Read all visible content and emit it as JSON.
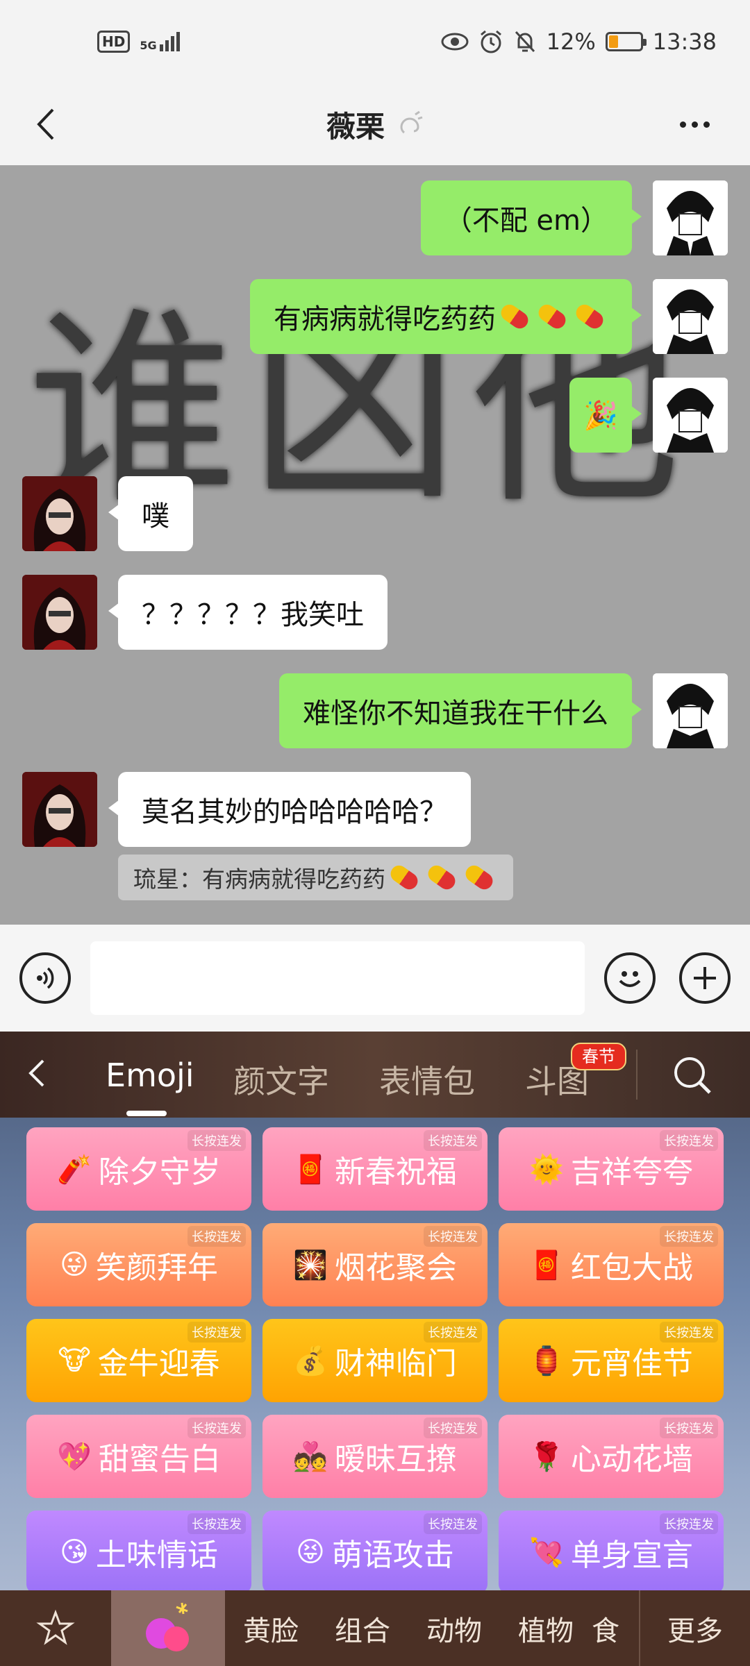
{
  "status_bar": {
    "hd_label": "HD",
    "network_label": "5G",
    "battery_percent": "12%",
    "battery_level": 0.12,
    "time": "13:38",
    "icons": [
      "eye-icon",
      "alarm-icon",
      "bell-mute-icon",
      "battery-icon"
    ]
  },
  "header": {
    "title": "薇栗",
    "back_icon": "chevron-left-icon",
    "more_icon": "more-dots-icon"
  },
  "chat": {
    "watermark_text": "谁凶他",
    "messages": [
      {
        "side": "out",
        "text": "（不配 em）"
      },
      {
        "side": "out",
        "text": "有病病就得吃药药"
      },
      {
        "side": "out",
        "text": "🎉"
      },
      {
        "side": "in",
        "text": "噗"
      },
      {
        "side": "in",
        "text": "？？？？？我笑吐"
      },
      {
        "side": "out",
        "text": "难怪你不知道我在干什么"
      },
      {
        "side": "in",
        "text": "莫名其妙的哈哈哈哈哈？"
      }
    ],
    "quote": "琉星：有病病就得吃药药"
  },
  "input": {
    "placeholder": "",
    "voice_icon": "voice-icon",
    "emoji_icon": "emoji-icon",
    "plus_icon": "plus-icon"
  },
  "keyboard": {
    "tabs": [
      "Emoji",
      "颜文字",
      "表情包",
      "斗图"
    ],
    "active_tab": "Emoji",
    "spring_badge": "春节",
    "long_press_label": "长按连发",
    "cards": [
      {
        "emoji": "🧨",
        "label": "除夕守岁",
        "color": "pink"
      },
      {
        "emoji": "🧧",
        "label": "新春祝福",
        "color": "pink"
      },
      {
        "emoji": "🌞",
        "label": "吉祥夸夸",
        "color": "pink"
      },
      {
        "emoji": "😜",
        "label": "笑颜拜年",
        "color": "orange"
      },
      {
        "emoji": "🎇",
        "label": "烟花聚会",
        "color": "orange"
      },
      {
        "emoji": "🧧",
        "label": "红包大战",
        "color": "orange"
      },
      {
        "emoji": "🐮",
        "label": "金牛迎春",
        "color": "yellow"
      },
      {
        "emoji": "💰",
        "label": "财神临门",
        "color": "yellow"
      },
      {
        "emoji": "🏮",
        "label": "元宵佳节",
        "color": "yellow"
      },
      {
        "emoji": "💖",
        "label": "甜蜜告白",
        "color": "pink"
      },
      {
        "emoji": "💑",
        "label": "暧昧互撩",
        "color": "pink"
      },
      {
        "emoji": "🌹",
        "label": "心动花墙",
        "color": "pink"
      },
      {
        "emoji": "😘",
        "label": "土味情话",
        "color": "purple"
      },
      {
        "emoji": "😝",
        "label": "萌语攻击",
        "color": "purple"
      },
      {
        "emoji": "💘",
        "label": "单身宣言",
        "color": "purple"
      }
    ],
    "categories": [
      "黄脸",
      "组合",
      "动物",
      "植物",
      "食"
    ],
    "more_label": "更多"
  }
}
